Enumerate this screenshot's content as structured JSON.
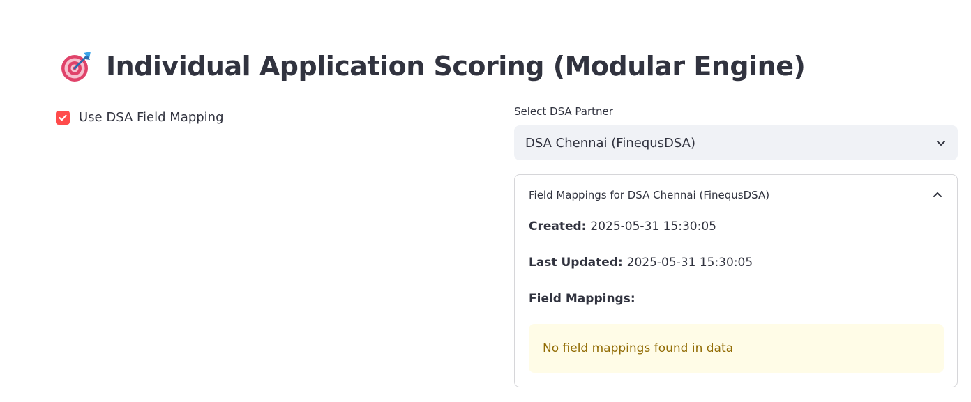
{
  "header": {
    "title": "Individual Application Scoring (Modular Engine)",
    "icon": "target-dart-icon"
  },
  "options": {
    "use_dsa_mapping_label": "Use DSA Field Mapping",
    "use_dsa_mapping_checked": true
  },
  "dsa_select": {
    "label": "Select DSA Partner",
    "value": "DSA Chennai (FinequsDSA)"
  },
  "expander": {
    "title": "Field Mappings for DSA Chennai (FinequsDSA)",
    "expanded": true,
    "created_label": "Created:",
    "created_value": "2025-05-31 15:30:05",
    "updated_label": "Last Updated:",
    "updated_value": "2025-05-31 15:30:05",
    "field_mappings_heading": "Field Mappings:",
    "warning_text": "No field mappings found in data"
  },
  "colors": {
    "accent": "#ff4b4b",
    "text": "#31333f",
    "select_bg": "#f0f2f6",
    "warning_bg": "#fffce7",
    "warning_text": "#926c05"
  }
}
